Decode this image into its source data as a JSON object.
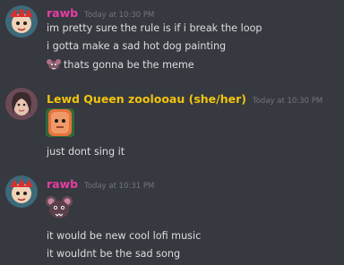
{
  "theme": {
    "background": "#36393f",
    "text": "#dcddde",
    "timestamp": "#72767d"
  },
  "messages": [
    {
      "author": "rawb",
      "author_color": "#e83ea4",
      "timestamp": "Today at 10:30 PM",
      "lines": [
        "im pretty sure the rule is if i break the loop",
        "i gotta make a sad hot dog painting",
        "thats gonna be the meme"
      ],
      "emoji": "rat-emoji"
    },
    {
      "author": "Lewd Queen zoolooau (she/her)",
      "author_color": "#f1c40f",
      "timestamp": "Today at 10:30 PM",
      "emoji": "face-emoji",
      "lines": [
        "just dont sing it"
      ]
    },
    {
      "author": "rawb",
      "author_color": "#e83ea4",
      "timestamp": "Today at 10:31 PM",
      "emoji": "rat-emoji",
      "lines": [
        "it would be new cool lofi music",
        "it wouldnt be the sad song"
      ]
    }
  ]
}
